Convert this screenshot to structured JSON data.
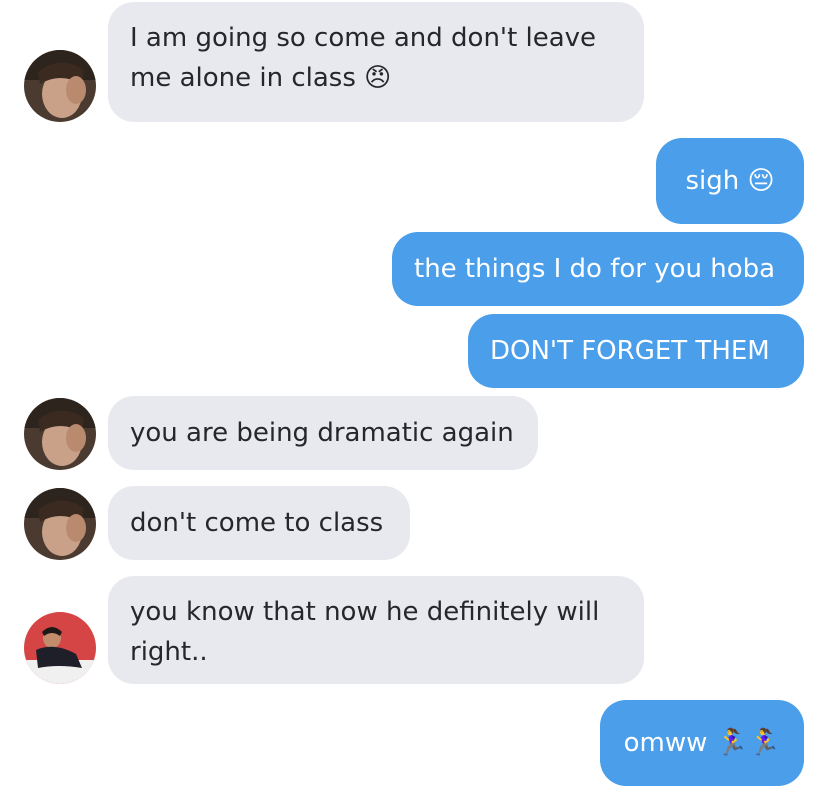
{
  "messages": [
    {
      "id": 1,
      "sender": "friend-1",
      "direction": "incoming",
      "text": "I am going so come and don't leave me alone in class 😠",
      "emoji_icon": "angry-face-icon"
    },
    {
      "id": 2,
      "sender": "me",
      "direction": "outgoing",
      "text": "sigh 😔",
      "emoji_icon": "pensive-face-icon"
    },
    {
      "id": 3,
      "sender": "me",
      "direction": "outgoing",
      "text": "the things I do for you hoba"
    },
    {
      "id": 4,
      "sender": "me",
      "direction": "outgoing",
      "text": "DON'T FORGET THEM"
    },
    {
      "id": 5,
      "sender": "friend-1",
      "direction": "incoming",
      "text": "you are being dramatic again"
    },
    {
      "id": 6,
      "sender": "friend-1",
      "direction": "incoming",
      "text": "don't come to class"
    },
    {
      "id": 7,
      "sender": "friend-2",
      "direction": "incoming",
      "text": "you know that now he definitely will right.."
    },
    {
      "id": 8,
      "sender": "me",
      "direction": "outgoing",
      "text": "omww 🏃‍♀️🏃‍♀️",
      "emoji_icon": "running-person-icon"
    }
  ],
  "colors": {
    "incoming_bubble": "#e7e9ee",
    "outgoing_bubble": "#4a9eea",
    "incoming_text": "#27272a",
    "outgoing_text": "#ffffff"
  }
}
